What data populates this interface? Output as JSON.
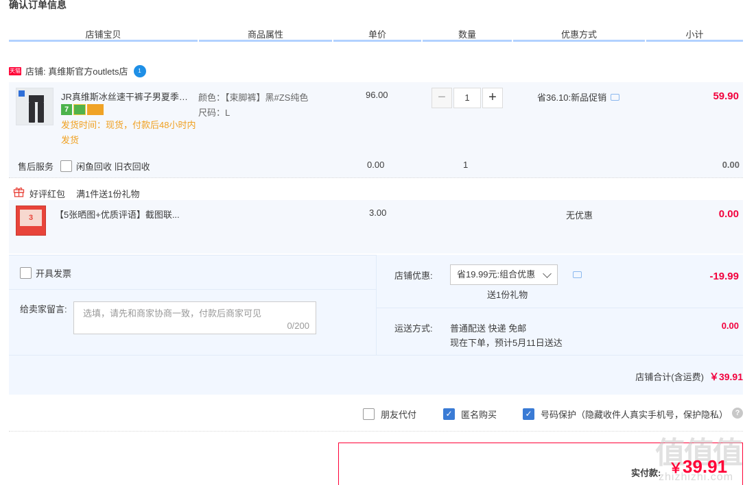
{
  "title": "确认订单信息",
  "columns": [
    "店铺宝贝",
    "商品属性",
    "单价",
    "数量",
    "优惠方式",
    "小计"
  ],
  "shop": {
    "badge": "天猫",
    "name": "店铺: 真维斯官方outlets店",
    "ww_badge": "1"
  },
  "item": {
    "title": "JR真维斯冰丝速干裤子男夏季薄...",
    "badges": [
      "7",
      "",
      ""
    ],
    "ship_time": "发货时间：现货，付款后48小时内发货",
    "color_attr": "颜色：【束脚裤】黑#ZS纯色",
    "size_attr": "尺码：L",
    "price": "96.00",
    "qty_minus": "−",
    "qty": "1",
    "qty_plus": "+",
    "promo": "省36.10:新品促销",
    "subtotal": "59.90"
  },
  "service": {
    "label": "售后服务",
    "option": "闲鱼回收 旧衣回收",
    "price": "0.00",
    "qty": "1",
    "subtotal": "0.00"
  },
  "gift": {
    "label": "好评红包",
    "desc": "满1件送1份礼物",
    "thumb_num": "3",
    "title": "【5张晒图+优质评语】截图联...",
    "price": "3.00",
    "promo": "无优惠",
    "subtotal": "0.00"
  },
  "invoice": {
    "label": "开具发票"
  },
  "message": {
    "label": "给卖家留言:",
    "placeholder": "选填，请先和商家协商一致，付款后商家可见",
    "counter": "0/200"
  },
  "shop_discount": {
    "label": "店铺优惠:",
    "selected": "省19.99元:组合优惠",
    "note": "送1份礼物",
    "amount": "-19.99"
  },
  "shipping": {
    "label": "运送方式:",
    "method": "普通配送 快递 免邮",
    "eta": "现在下单，预计5月11日送达",
    "amount": "0.00"
  },
  "shop_total": {
    "label": "店铺合计(含运费)",
    "amount": "￥39.91"
  },
  "options": {
    "friend_pay": "朋友代付",
    "anonymous": "匿名购买",
    "number_protect": "号码保护（隐藏收件人真实手机号，保护隐私）"
  },
  "payment": {
    "label": "实付款:",
    "currency": "￥",
    "amount": "39.91"
  },
  "watermark": {
    "main": "值值值",
    "sub": "zhizhizhi.com"
  },
  "colors": {
    "accent": "#ff0036",
    "blue": "#3a7bd5",
    "header_line": "#b2d1ff"
  }
}
